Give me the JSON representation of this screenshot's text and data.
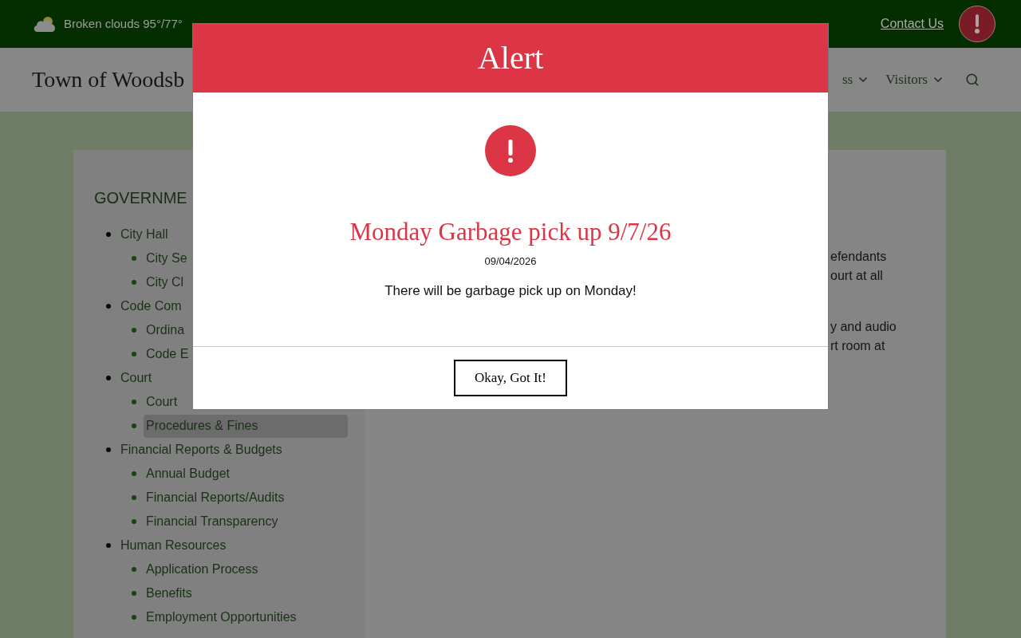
{
  "top_bar": {
    "weather": "Broken clouds 95°/77°",
    "contact_link": "Contact Us"
  },
  "header": {
    "site_title": "Town of Woodsb",
    "nav": [
      {
        "label": "ss",
        "dropdown": true
      },
      {
        "label": "Visitors",
        "dropdown": true
      }
    ]
  },
  "sidebar": {
    "heading": "GOVERNME",
    "items": [
      {
        "label": "City Hall",
        "selected": false,
        "children": [
          {
            "label": "City Se",
            "selected": false
          },
          {
            "label": "City Cl",
            "selected": false
          }
        ]
      },
      {
        "label": "Code Com",
        "selected": false,
        "children": [
          {
            "label": "Ordina",
            "selected": false
          },
          {
            "label": "Code E",
            "selected": false
          }
        ]
      },
      {
        "label": "Court",
        "selected": false,
        "children": [
          {
            "label": "Court",
            "selected": false
          },
          {
            "label": "Procedures & Fines",
            "selected": true
          }
        ]
      },
      {
        "label": "Financial Reports & Budgets",
        "selected": false,
        "children": [
          {
            "label": "Annual Budget",
            "selected": false
          },
          {
            "label": "Financial Reports/Audits",
            "selected": false
          },
          {
            "label": "Financial Transparency",
            "selected": false
          }
        ]
      },
      {
        "label": "Human Resources",
        "selected": false,
        "children": [
          {
            "label": "Application Process",
            "selected": false
          },
          {
            "label": "Benefits",
            "selected": false
          },
          {
            "label": "Employment Opportunities",
            "selected": false
          }
        ]
      }
    ]
  },
  "content": {
    "paragraphs": [
      {
        "lines": [
          "efendants",
          "ourt at all"
        ]
      },
      {
        "lines": [
          "y and audio",
          "rt room at"
        ]
      }
    ]
  },
  "alert_modal": {
    "title": "Alert",
    "heading": "Monday Garbage pick up 9/7/26",
    "date": "09/04/2026",
    "message": "There will be garbage pick up on Monday!",
    "button": "Okay, Got It!"
  }
}
